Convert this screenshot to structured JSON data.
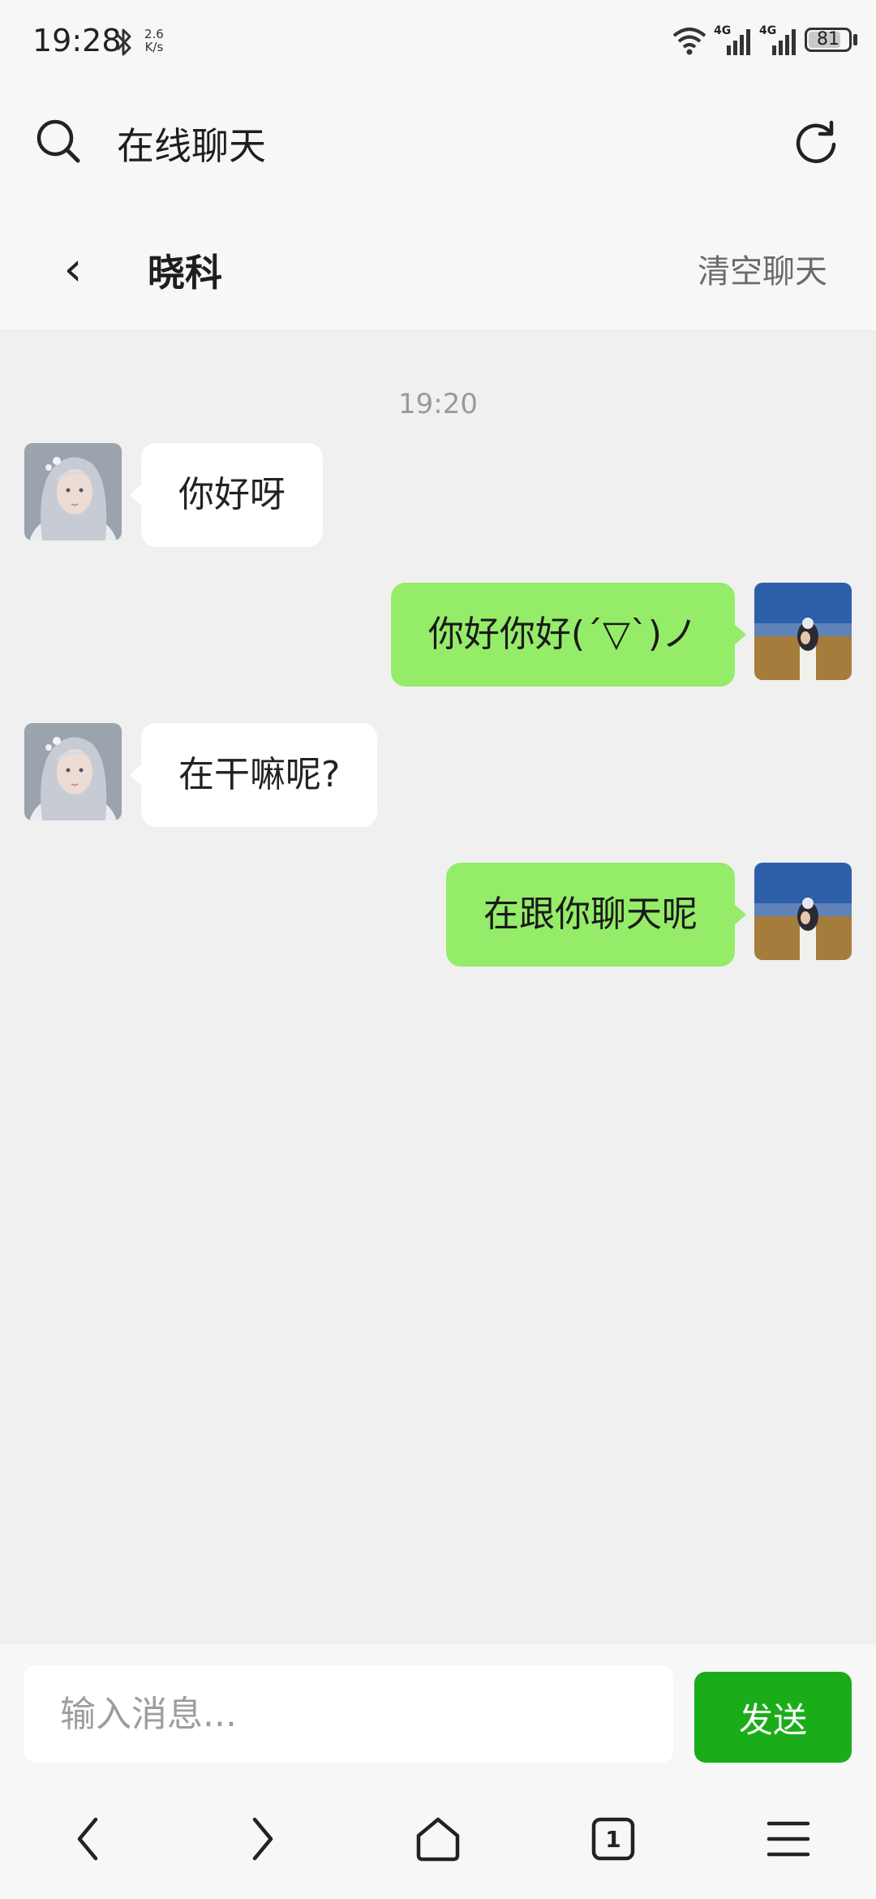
{
  "status_bar": {
    "time": "19:28",
    "net_speed_value": "2.6",
    "net_speed_unit": "K/s",
    "network_1": "4G",
    "network_2": "4G",
    "battery": "81",
    "battery_level": 0.81
  },
  "browser": {
    "title": "在线聊天"
  },
  "chat": {
    "contact_name": "晓科",
    "back_label": "‹",
    "clear_label": "清空聊天",
    "timestamp": "19:20",
    "messages": [
      {
        "side": "left",
        "text": "你好呀"
      },
      {
        "side": "right",
        "text": "你好你好(´▽`)ノ"
      },
      {
        "side": "left",
        "text": "在干嘛呢?"
      },
      {
        "side": "right",
        "text": "在跟你聊天呢"
      }
    ]
  },
  "input": {
    "placeholder": "输入消息...",
    "value": "",
    "send_label": "发送"
  },
  "bottom_nav": {
    "tab_count": "1",
    "icons": [
      "back-icon",
      "forward-icon",
      "home-icon",
      "tabs-icon",
      "menu-icon"
    ]
  },
  "colors": {
    "self_bubble": "#95ec69",
    "other_bubble": "#ffffff",
    "send_button": "#1aad19",
    "chat_background": "#f0f0f0"
  }
}
